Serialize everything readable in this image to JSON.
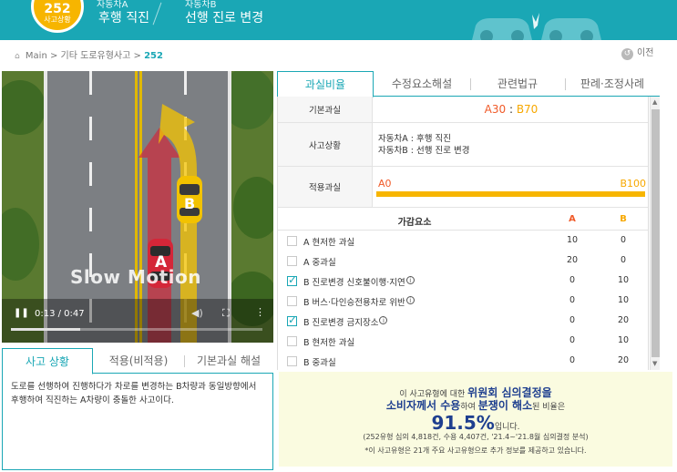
{
  "header": {
    "case_number": "252",
    "case_label": "사고상황",
    "car_a_label": "자동차A",
    "car_a_desc": "후행 직진",
    "car_b_label": "자동차B",
    "car_b_desc": "선행 진로 변경",
    "accent_color": "#1aa7b5",
    "badge_color": "#f7b500"
  },
  "breadcrumb": {
    "home": "Main",
    "sep1": ">",
    "category": "기타 도로유형사고",
    "sep2": ">",
    "current": "252",
    "home_icon": "home-icon"
  },
  "back": {
    "icon": "back-arrow-icon",
    "label": "이전"
  },
  "video": {
    "overlay_text": "Slow Motion",
    "time": "0:13 / 0:47",
    "progress": 0.277,
    "car_a": "A",
    "car_b": "B"
  },
  "left_tabs": [
    "사고 상황",
    "적용(비적용)",
    "기본과실 해설"
  ],
  "left_description": "도로를 선행하여 진행하다가 차로를 변경하는 B차량과 동일방향에서 후행하여 직진하는 A차량이 충돌한 사고이다.",
  "right_tabs": [
    "과실비율",
    "수정요소해설",
    "관련법규",
    "판례·조정사례"
  ],
  "fault": {
    "basic_label": "기본과실",
    "basic_a": "A30",
    "basic_sep": " : ",
    "basic_b": "B70",
    "situation_label": "사고상황",
    "situation_lines": [
      "자동차A : 후행 직진",
      "자동차B : 선행 진로 변경"
    ],
    "applied_label": "적용과실",
    "applied_a": "A0",
    "applied_b": "B100",
    "applied_b_value": 100
  },
  "adjust": {
    "header": "가감요소",
    "col_a": "A",
    "col_b": "B",
    "rows": [
      {
        "label": "A 현저한 과실",
        "a": "10",
        "b": "0",
        "checked": false,
        "info": false
      },
      {
        "label": "A 중과실",
        "a": "20",
        "b": "0",
        "checked": false,
        "info": false
      },
      {
        "label": "B 진로변경 신호불이행·지연",
        "a": "0",
        "b": "10",
        "checked": true,
        "info": true
      },
      {
        "label": "B 버스·다인승전용차로 위반",
        "a": "0",
        "b": "10",
        "checked": false,
        "info": true
      },
      {
        "label": "B 진로변경 금지장소",
        "a": "0",
        "b": "20",
        "checked": true,
        "info": true
      },
      {
        "label": "B 현저한 과실",
        "a": "0",
        "b": "10",
        "checked": false,
        "info": false
      },
      {
        "label": "B 중과실",
        "a": "0",
        "b": "20",
        "checked": false,
        "info": false
      }
    ]
  },
  "info_box": {
    "line1_pre": "이 사고유형에 대한 ",
    "line1_bold": "위원회 심의결정을",
    "line2_bold1": "소비자께서 수용",
    "line2_mid": "하여 ",
    "line2_bold2": "분쟁이 해소",
    "line2_post": "된 비율은",
    "percent": "91.5%",
    "percent_post": "입니다.",
    "line4": "(252유형 심의 4,818건, 수용 4,407건, '21.4~'21.8월 심의결정 분석)",
    "line5": "*이 사고유형은 21개 주요 사고유형으로 추가 정보를 제공하고 있습니다.",
    "bg_color": "#fafbe0"
  }
}
